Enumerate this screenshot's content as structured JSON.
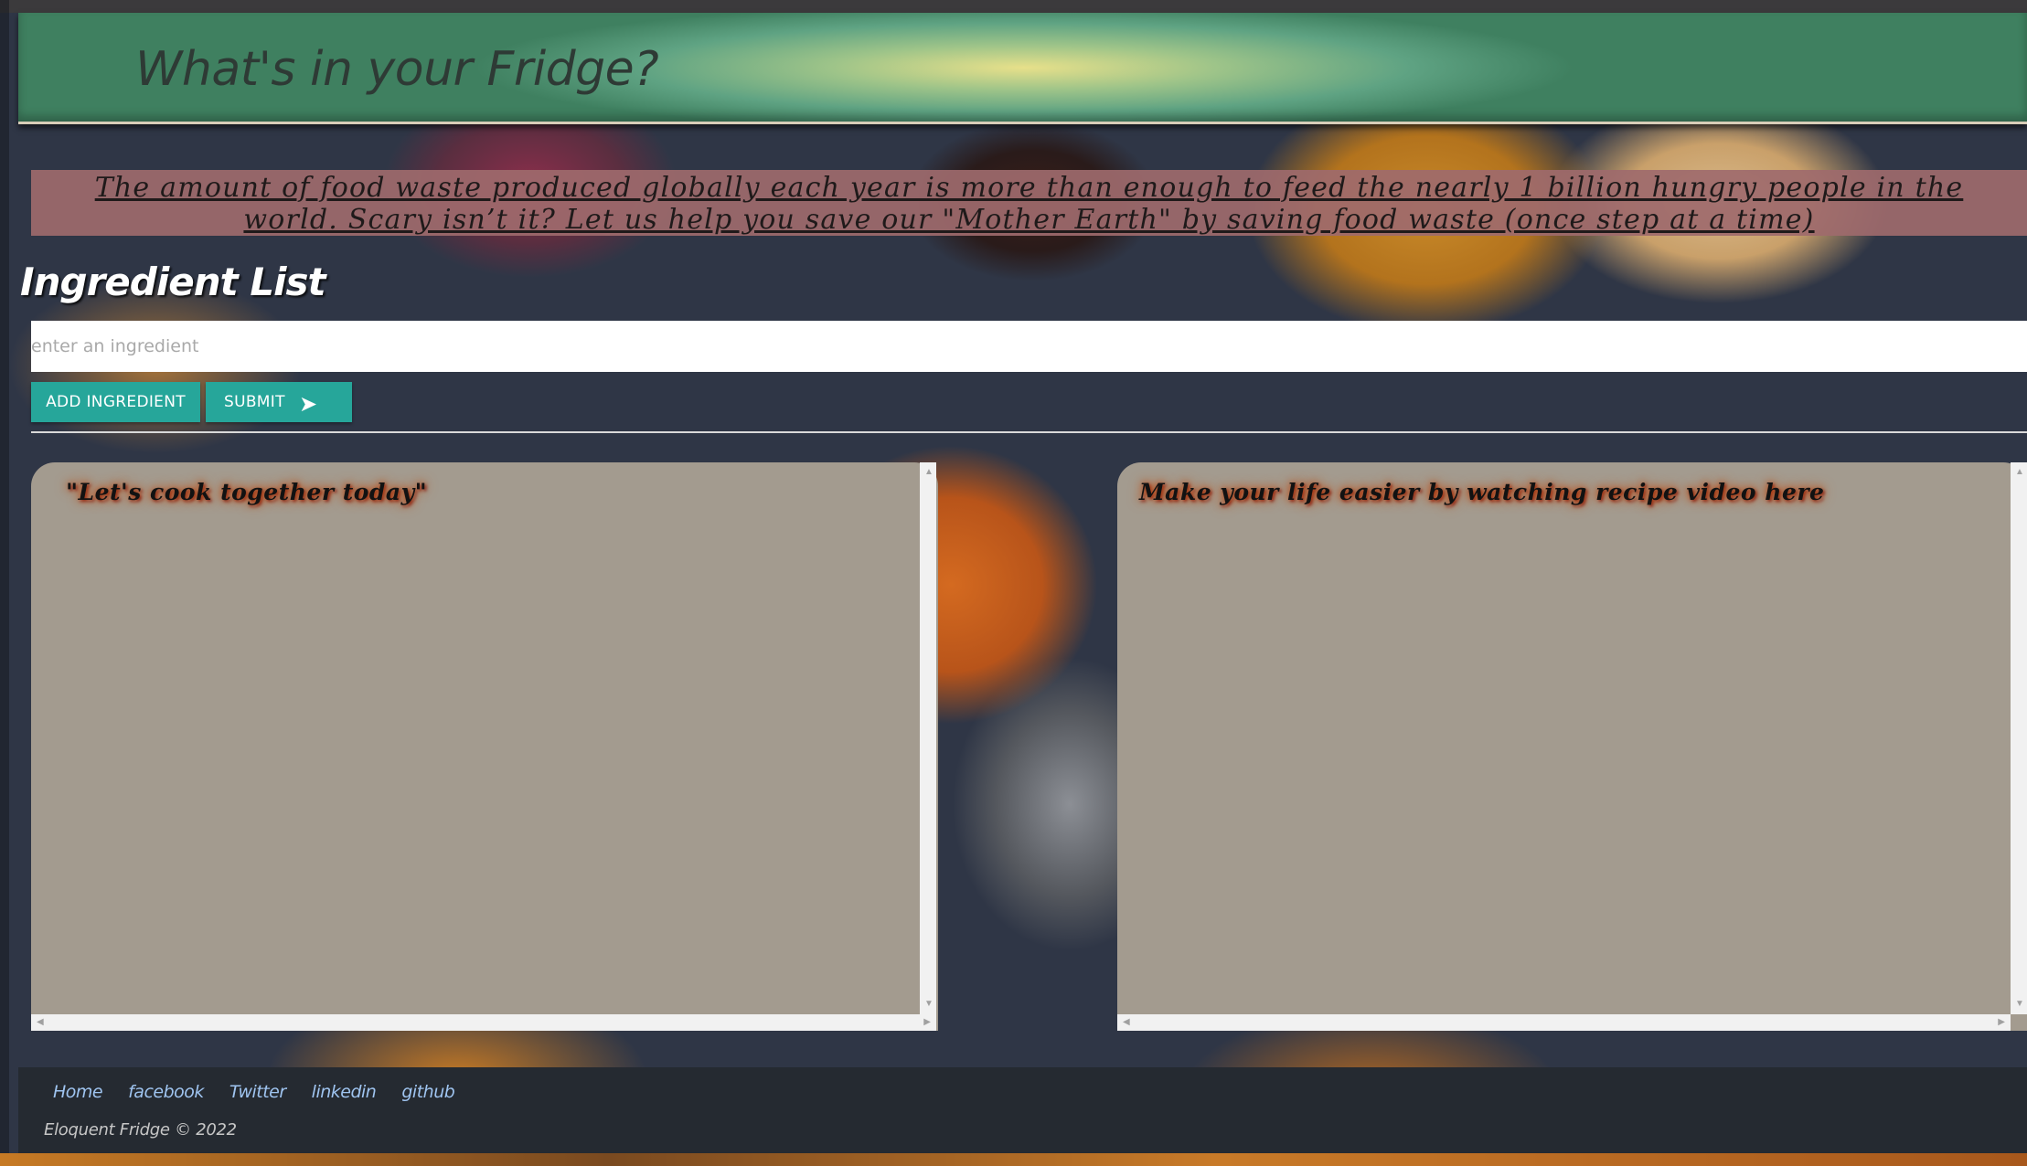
{
  "header": {
    "title": "What's in your Fridge?"
  },
  "quote": {
    "text": "The amount of food waste produced globally each year is more than enough to feed the nearly 1 billion hungry people in the world. Scary isn’t it? Let us help you save our \"Mother Earth\" by saving food waste (once step at a time)"
  },
  "ingredients": {
    "heading": "Ingredient List",
    "input_value": "",
    "input_placeholder": "enter an ingredient",
    "add_label": "ADD INGREDIENT",
    "submit_label": "SUBMIT",
    "submit_icon": "send-icon"
  },
  "panels": {
    "recipes_title": "\"Let's cook together today\"",
    "videos_title": "Make your life easier by watching recipe video here"
  },
  "footer": {
    "links": [
      "Home",
      "facebook",
      "Twitter",
      "linkedin",
      "github"
    ],
    "copyright": "Eloquent Fridge © 2022"
  },
  "colors": {
    "accent": "#26a69a",
    "panel_bg": "#a39b8f",
    "quote_bg": "#9e6a6c",
    "footer_bg": "#252a31",
    "footer_link": "#9fc4f0"
  }
}
